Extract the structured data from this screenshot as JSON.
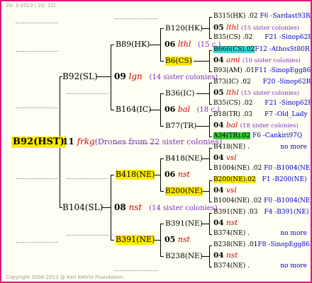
{
  "header_text": "20-  3-2013 ( 22: 22)",
  "copyright": "Copyright 2008-2013 @ Karl Kehrle Foundation.",
  "root": {
    "label": "B92(HST)",
    "year": "11",
    "prefix": "frkg",
    "note": "(Drones from 22 sister colonies)"
  },
  "gen1": [
    {
      "label": "B92(SL)",
      "year": "09",
      "prefix": "lgn",
      "note": "(14 sister colonies)"
    },
    {
      "label": "B104(SL)",
      "year": "08",
      "prefix": "nst",
      "note": "(14 sister colonies)"
    }
  ],
  "gen2": [
    {
      "label": "B89(HK)",
      "year": "06",
      "prefix": "lthl",
      "note": "(15 c.)"
    },
    {
      "label": "B164(IC)",
      "year": "06",
      "prefix": "bal",
      "note": "(18 c.)"
    },
    {
      "label": "B418(NE)",
      "year": "06",
      "prefix": "nst",
      "note": ""
    },
    {
      "label": "B391(NE)",
      "year": "05",
      "prefix": "nst",
      "note": ""
    }
  ],
  "gen3": [
    {
      "label": "B120(HK)",
      "year": "05",
      "prefix": "lthl",
      "note": "(15 sister colonies)"
    },
    {
      "label": "B6(CS)",
      "year": "04",
      "prefix": "ami",
      "note": "(10 sister colonies)"
    },
    {
      "label": "B36(IC)",
      "year": "05",
      "prefix": "lthl",
      "note": "(15 sister colonies)"
    },
    {
      "label": "B77(TR)",
      "year": "04",
      "prefix": "bal",
      "note": "(18 sister colonies)"
    },
    {
      "label": "B418(NE)",
      "year": "04",
      "prefix": "vsl",
      "note": ""
    },
    {
      "label": "B200(NE)",
      "year": "04",
      "prefix": "vsl",
      "note": ""
    },
    {
      "label": "B391(NE)",
      "year": "04",
      "prefix": "nst",
      "note": ""
    },
    {
      "label": "B238(NE)",
      "year": "04",
      "prefix": "nst",
      "note": ""
    }
  ],
  "gen4": [
    {
      "label": "B315(HK)",
      "year": ".02",
      "loc": "F6 -Sardast93R"
    },
    {
      "label": "B35(CS)",
      "year": ".02",
      "loc": "F21 -Sinop62R"
    },
    {
      "label": "B666(CS)",
      "year": ".02",
      "loc": "F12 -AthosSt80R"
    },
    {
      "label": "B93(AM)",
      "year": ".01",
      "loc": "F11 -SinopEgg86R"
    },
    {
      "label": "B73(IC)",
      "year": ".02",
      "loc": "F20 -Sinop62R"
    },
    {
      "label": "B35(CS)",
      "year": ".02",
      "loc": "F21 -Sinop62R"
    },
    {
      "label": "B18(TR)",
      "year": ".03",
      "loc": "F7 -Old_Lady"
    },
    {
      "label": "A34(TR)",
      "year": ".02",
      "loc": "F6 -Cankiri97Q"
    },
    {
      "label": "B418(NE)",
      "year": ".",
      "loc": "no more"
    },
    {
      "label": "B1004(NE)",
      "year": ".02",
      "loc": "F0 -B1004(NE)"
    },
    {
      "label": "B200(NE)",
      "year": ".02",
      "loc": "F1 -B200(NE)"
    },
    {
      "label": "B1004(NE)",
      "year": ".02",
      "loc": "F0 -B1004(NE)"
    },
    {
      "label": "B391(NE)",
      "year": ".03",
      "loc": "F4 -B391(NE)"
    },
    {
      "label": "B374(NE)",
      "year": ".",
      "loc": "no more"
    },
    {
      "label": "B238(NE)",
      "year": ".01",
      "loc": "F8 -SinopEgg86R"
    },
    {
      "label": "B374(NE)",
      "year": ".",
      "loc": "no more"
    }
  ],
  "colors": {
    "frame": "#e0177a",
    "highlight_yellow": "#ffea00",
    "highlight_cyan": "#33d8d8",
    "highlight_green": "#33cc33",
    "prefix_red": "#d40000",
    "note_purple": "#7b2fbf",
    "loc_blue": "#0000cc"
  }
}
